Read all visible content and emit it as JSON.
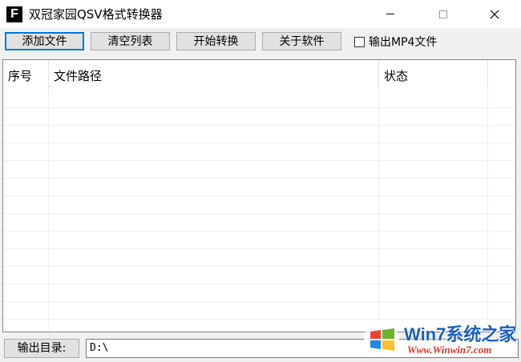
{
  "window": {
    "title": "双冠家园QSV格式转换器",
    "icon_letter": "F"
  },
  "toolbar": {
    "add_files": "添加文件",
    "clear_list": "清空列表",
    "start_convert": "开始转换",
    "about": "关于软件",
    "output_mp4_label": "输出MP4文件",
    "output_mp4_checked": false
  },
  "list": {
    "columns": [
      "序号",
      "文件路径",
      "状态"
    ],
    "rows": []
  },
  "output": {
    "label": "输出目录:",
    "value": "D:\\"
  },
  "watermark": {
    "brand": "Win7系统之家",
    "url": "Www.Winwin7.com"
  },
  "colors": {
    "accent": "#0078d7",
    "button_bg": "#e1e1e1",
    "window_bg": "#f0f0f0"
  }
}
